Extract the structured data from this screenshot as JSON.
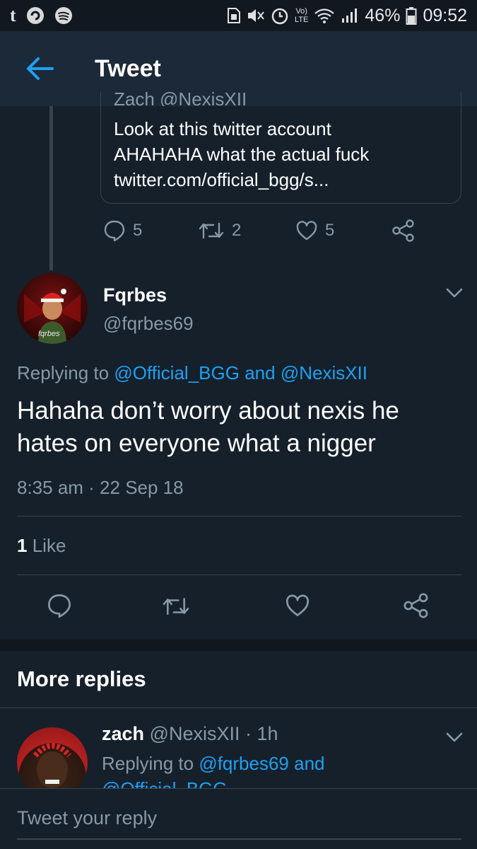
{
  "status_bar": {
    "battery": "46%",
    "time": "09:52",
    "network_label_top": "Vo)",
    "network_label_bottom": "LTE",
    "app_icons": [
      "tumblr-icon",
      "unknown-app-icon",
      "spotify-icon"
    ]
  },
  "header": {
    "title": "Tweet"
  },
  "quoted_tweet": {
    "cut_text": "Zach @NexisXII",
    "lines": [
      "Look at this twitter account",
      "AHAHAHA what the actual fuck",
      "twitter.com/official_bgg/s..."
    ]
  },
  "parent_actions": {
    "replies": "5",
    "retweets": "2",
    "likes": "5"
  },
  "tweet": {
    "display_name": "Fqrbes",
    "handle": "@fqrbes69",
    "replying_prefix": "Replying to",
    "reply_to_1": "@Official_BGG",
    "reply_and": "and",
    "reply_to_2": "@NexisXII",
    "text_lines": [
      "Hahaha don’t worry about nexis he",
      "hates on everyone what a nigger"
    ],
    "timestamp": "8:35 am · 22 Sep 18",
    "like_count": "1",
    "like_label": "Like"
  },
  "more_replies": {
    "heading": "More replies",
    "reply": {
      "display_name": "zach",
      "handle_time": "@NexisXII · 1h",
      "replying_prefix": "Replying to",
      "reply_to": "@fqrbes69",
      "reply_and": "and",
      "cut_text": "@Official_BGG"
    }
  },
  "composer": {
    "placeholder": "Tweet your reply"
  },
  "colors": {
    "background": "#15202b",
    "header": "#1c2938",
    "accent": "#1da1f2",
    "muted": "#8899a6",
    "border": "#38444d"
  }
}
